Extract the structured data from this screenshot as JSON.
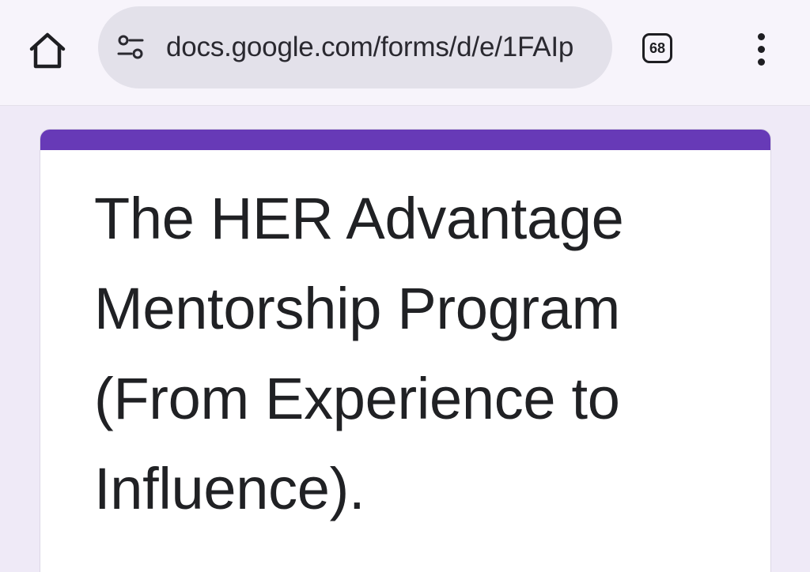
{
  "browser": {
    "url": "docs.google.com/forms/d/e/1FAIp",
    "tab_count": "68",
    "icons": {
      "home": "home-icon",
      "site_settings": "tune-icon",
      "overflow": "more-vert-icon"
    }
  },
  "form": {
    "title": "The HER Advantage Mentorship Program (From Experience to Influence).",
    "accent_color": "#673ab7"
  }
}
